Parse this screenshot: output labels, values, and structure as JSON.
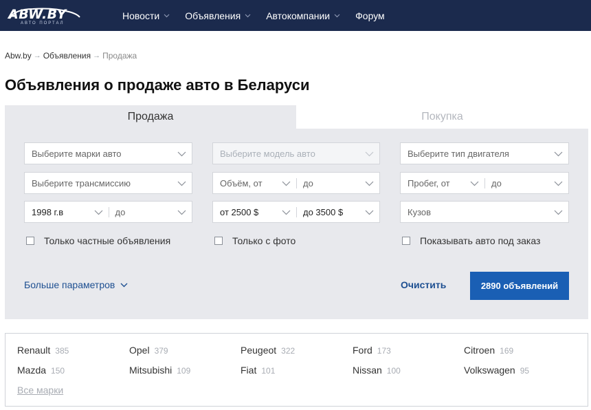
{
  "header": {
    "logo_text": "ABW.BY",
    "logo_sub": "АВТО ПОРТАЛ",
    "nav": [
      {
        "label": "Новости"
      },
      {
        "label": "Объявления"
      },
      {
        "label": "Автокомпании"
      },
      {
        "label": "Форум"
      }
    ]
  },
  "breadcrumb": {
    "home": "Abw.by",
    "section": "Объявления",
    "current": "Продажа",
    "separator": "→"
  },
  "page_title": "Объявления о продаже авто в Беларуси",
  "tabs": {
    "sale": "Продажа",
    "purchase": "Покупка"
  },
  "filters": {
    "make": "Выберите марки авто",
    "model": "Выберите модель авто",
    "engine": "Выберите тип двигателя",
    "transmission": "Выберите трансмиссию",
    "volume_from": "Объём, от",
    "volume_to": "до",
    "mileage_from": "Пробег, от",
    "mileage_to": "до",
    "year_from": "1998 г.в",
    "year_to": "до",
    "price_from": "от 2500 $",
    "price_to": "до 3500 $",
    "body": "Кузов"
  },
  "checkboxes": {
    "private": "Только частные объявления",
    "photo": "Только с фото",
    "custom_order": "Показывать авто под заказ"
  },
  "actions": {
    "more_params": "Больше параметров",
    "clear": "Очистить",
    "submit": "2890 объявлений"
  },
  "brands": [
    {
      "name": "Renault",
      "count": "385"
    },
    {
      "name": "Opel",
      "count": "379"
    },
    {
      "name": "Peugeot",
      "count": "322"
    },
    {
      "name": "Ford",
      "count": "173"
    },
    {
      "name": "Citroen",
      "count": "169"
    },
    {
      "name": "Mazda",
      "count": "150"
    },
    {
      "name": "Mitsubishi",
      "count": "109"
    },
    {
      "name": "Fiat",
      "count": "101"
    },
    {
      "name": "Nissan",
      "count": "100"
    },
    {
      "name": "Volkswagen",
      "count": "95"
    }
  ],
  "all_brands": "Все марки",
  "colors": {
    "header_bg": "#1b2a4d",
    "panel_bg": "#e8e9ed",
    "accent": "#1a5fb4",
    "link": "#1d4f91"
  },
  "icons": {
    "nav_dropdown": "chevron-down-icon",
    "select_dropdown": "chevron-down-icon",
    "checkbox": "checkbox-icon",
    "logo": "car-logo-icon"
  }
}
